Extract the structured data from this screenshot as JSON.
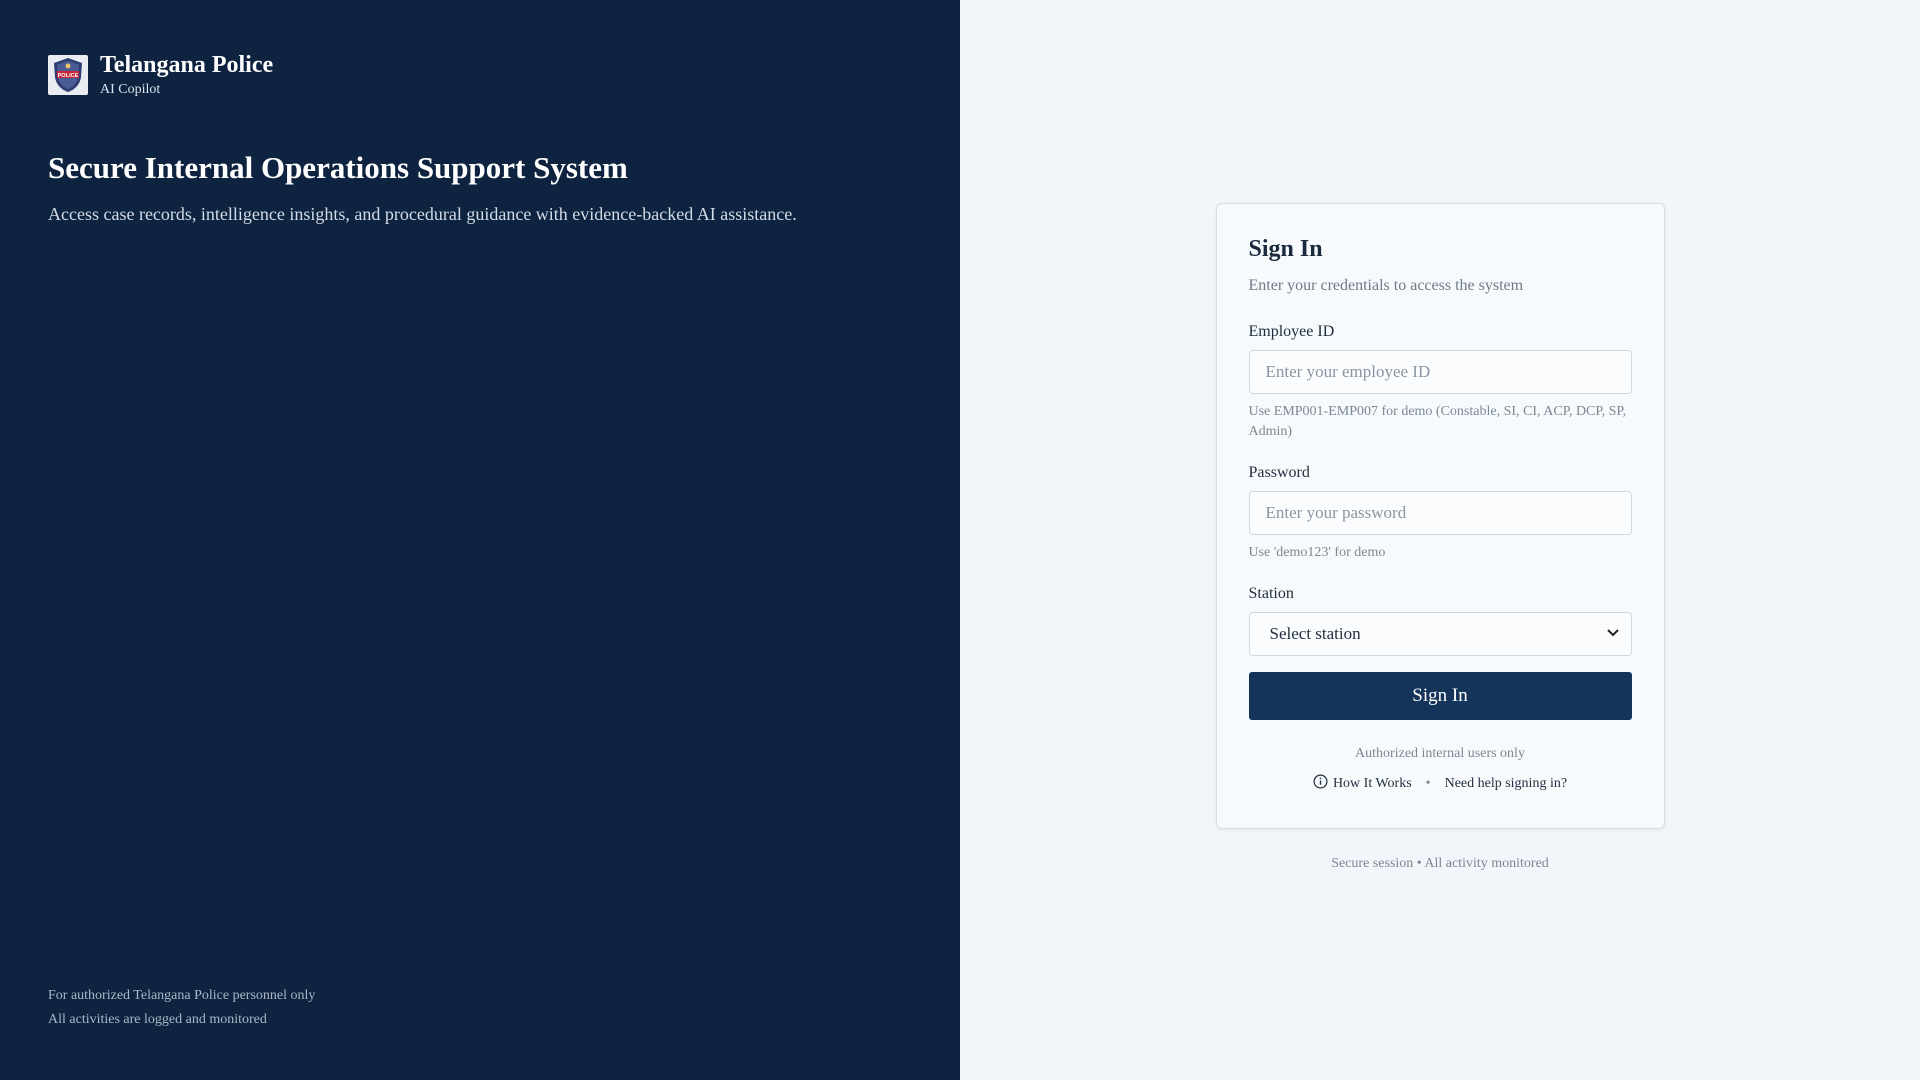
{
  "brand": {
    "name": "Telangana Police",
    "subtitle": "AI Copilot",
    "logo_text": "POLICE"
  },
  "hero": {
    "headline": "Secure Internal Operations Support System",
    "lead": "Access case records, intelligence insights, and procedural guidance with evidence-backed AI assistance."
  },
  "left_footer": {
    "line1": "For authorized Telangana Police personnel only",
    "line2": "All activities are logged and monitored"
  },
  "signin": {
    "title": "Sign In",
    "subtitle": "Enter your credentials to access the system",
    "employee_label": "Employee ID",
    "employee_placeholder": "Enter your employee ID",
    "employee_hint": "Use EMP001-EMP007 for demo (Constable, SI, CI, ACP, DCP, SP, Admin)",
    "password_label": "Password",
    "password_placeholder": "Enter your password",
    "password_hint": "Use 'demo123' for demo",
    "station_label": "Station",
    "station_selected": "Select station",
    "submit_label": "Sign In",
    "authorized_note": "Authorized internal users only",
    "how_it_works": "How It Works",
    "separator": "•",
    "help_link": "Need help signing in?"
  },
  "secure_note": "Secure session • All activity monitored",
  "colors": {
    "panel": "#0e2340",
    "button": "#14345a",
    "page": "#f2f5f9"
  },
  "icons": {
    "logo": "police-shield-icon",
    "info": "info-circle-icon",
    "dropdown": "chevron-down-icon"
  }
}
